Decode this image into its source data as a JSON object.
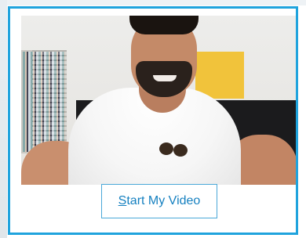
{
  "video_preview": {
    "description_icon": "camera-preview"
  },
  "actions": {
    "start_video_mnemonic": "S",
    "start_video_rest": "tart My Video"
  },
  "colors": {
    "frame_border": "#1fa3dd",
    "button_text": "#1580c0",
    "button_border": "#4aa8d8"
  }
}
